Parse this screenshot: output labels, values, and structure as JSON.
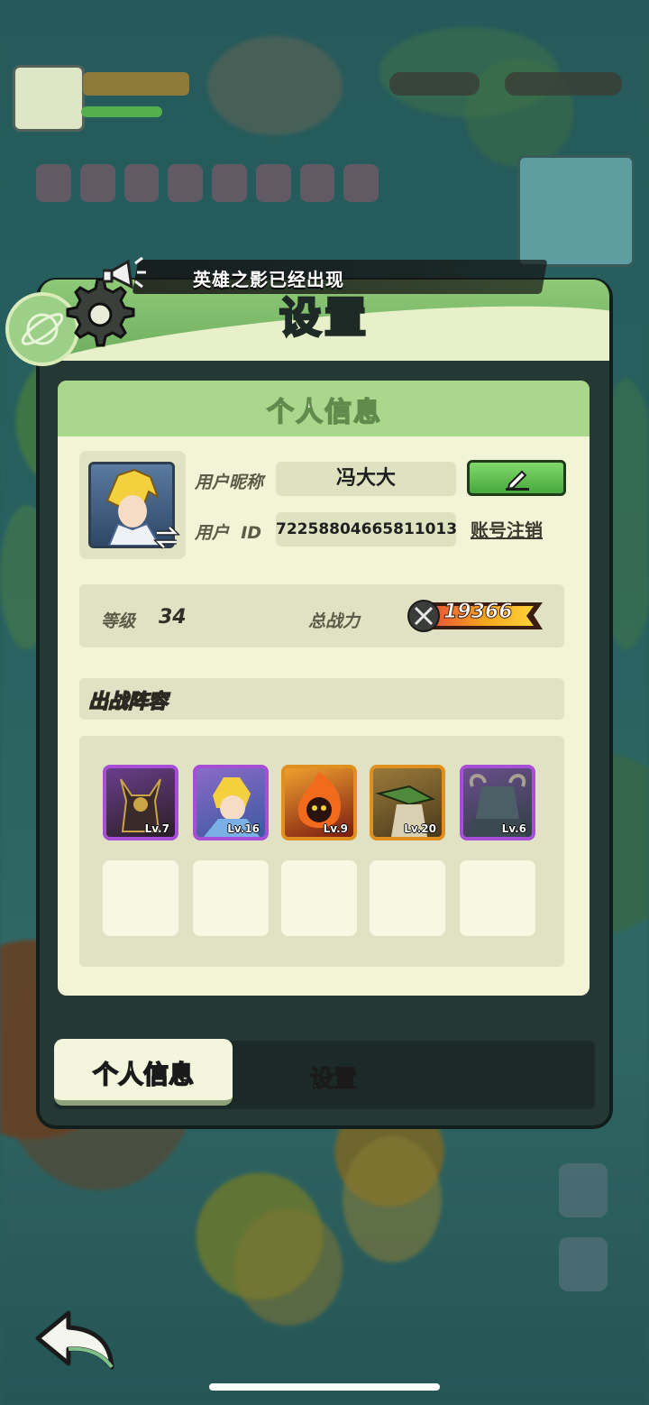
{
  "banner": {
    "text": "英雄之影已经出现"
  },
  "panel": {
    "title": "设置"
  },
  "card": {
    "header": "个人信息"
  },
  "profile": {
    "nickname_label": "用户昵称",
    "nickname": "冯大大",
    "id_label": "用户  ID",
    "user_id": "72258804665811013",
    "logout_label": "账号注销"
  },
  "stats": {
    "level_label": "等级",
    "level": "34",
    "power_label": "总战力",
    "power": "19366"
  },
  "lineup": {
    "title": "出战阵容",
    "heroes": [
      {
        "level": "Lv.7",
        "rarity": "purple",
        "color": "#3b2a2a"
      },
      {
        "level": "Lv.16",
        "rarity": "purple",
        "color": "#6a8ac8"
      },
      {
        "level": "Lv.9",
        "rarity": "orange",
        "color": "#c2411a"
      },
      {
        "level": "Lv.20",
        "rarity": "orange",
        "color": "#6f5a2f"
      },
      {
        "level": "Lv.6",
        "rarity": "purple",
        "color": "#4c5f66"
      }
    ],
    "empty_slots": 5
  },
  "tabs": {
    "active": "个人信息",
    "other": "设置"
  },
  "icons": [
    "gear-icon",
    "megaphone-icon",
    "planet-icon",
    "swap-icon",
    "pencil-icon",
    "sword-icon",
    "back-arrow-icon"
  ],
  "colors": {
    "accent_green": "#6fae5f",
    "card_bg": "#f1f4d6",
    "epic": "#a64fd6",
    "legendary": "#e0901f"
  }
}
